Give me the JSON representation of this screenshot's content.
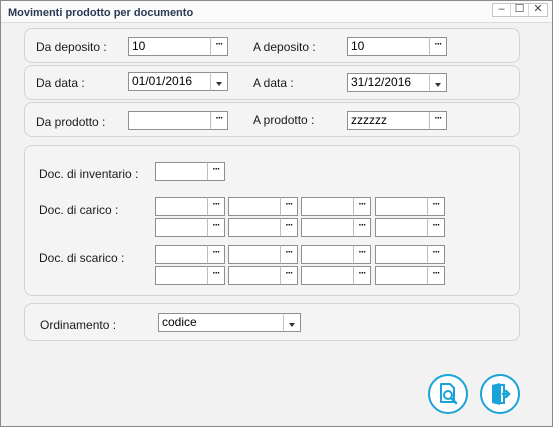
{
  "window": {
    "title": "Movimenti prodotto per documento",
    "controls": {
      "minimize": "‒",
      "maximize": "☐",
      "close": "✕"
    }
  },
  "deposito": {
    "from_label": "Da deposito  :",
    "from_value": "10",
    "to_label": "A deposito  :",
    "to_value": "10"
  },
  "data": {
    "from_label": "Da data :",
    "from_value": "01/01/2016",
    "to_label": "A data :",
    "to_value": "31/12/2016"
  },
  "prodotto": {
    "from_label": "Da prodotto :",
    "from_value": "",
    "to_label": "A prodotto :",
    "to_value": "zzzzzz"
  },
  "documenti": {
    "inventario_label": "Doc. di inventario :",
    "inventario_value": "",
    "carico_label": "Doc. di carico :",
    "scarico_label": "Doc. di scarico :"
  },
  "ordinamento": {
    "label": "Ordinamento :",
    "value": "codice"
  },
  "lookup_glyph": "···",
  "icons": {
    "preview": "preview-search-icon",
    "exit": "exit-door-icon"
  },
  "colors": {
    "accent": "#1aa3d9",
    "title_text": "#2a3a55"
  }
}
